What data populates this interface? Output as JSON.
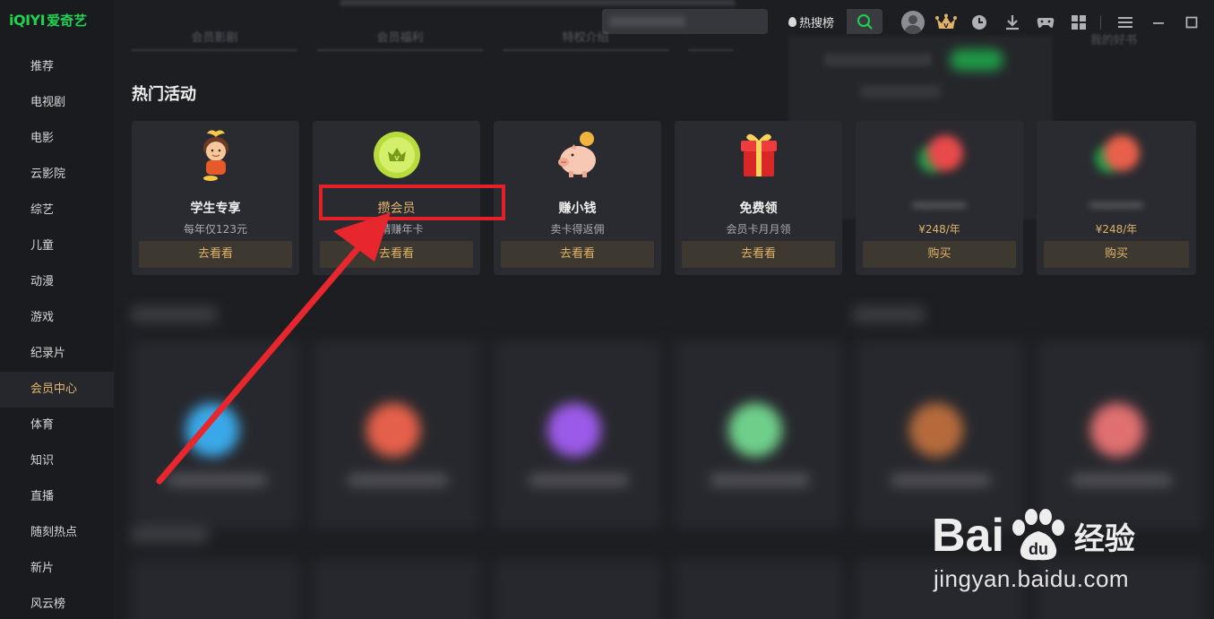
{
  "app": {
    "brand": "iQIYI",
    "brand_cn": "爱奇艺",
    "brand_color": "#1fd24f",
    "accent_color": "#e0b36a"
  },
  "sidebar": {
    "items": [
      {
        "label": "推荐"
      },
      {
        "label": "电视剧"
      },
      {
        "label": "电影"
      },
      {
        "label": "云影院"
      },
      {
        "label": "综艺"
      },
      {
        "label": "儿童"
      },
      {
        "label": "动漫"
      },
      {
        "label": "游戏"
      },
      {
        "label": "纪录片"
      },
      {
        "label": "会员中心",
        "active": true
      },
      {
        "label": "体育"
      },
      {
        "label": "知识"
      },
      {
        "label": "直播"
      },
      {
        "label": "随刻热点"
      },
      {
        "label": "新片"
      },
      {
        "label": "风云榜"
      }
    ]
  },
  "topbar": {
    "hot_list_label": "热搜榜",
    "icons": [
      "avatar",
      "vip-crown-icon",
      "history-icon",
      "download-icon",
      "game-icon",
      "apps-grid-icon",
      "menu-icon",
      "minimize-icon",
      "maximize-icon"
    ]
  },
  "categories": [
    "会员影剧",
    "会员福利",
    "特权介绍",
    "我的好书"
  ],
  "section": {
    "title": "热门活动"
  },
  "cards": [
    {
      "title": "学生专享",
      "sub": "每年仅123元",
      "button": "去看看",
      "icon": "student-mascot-icon"
    },
    {
      "title": "攒会员",
      "sub": "邀请赚年卡",
      "button": "去看看",
      "icon": "vip-coin-icon"
    },
    {
      "title": "赚小钱",
      "sub": "卖卡得返佣",
      "button": "去看看",
      "icon": "piggy-bank-icon"
    },
    {
      "title": "免费领",
      "sub": "会员卡月月领",
      "button": "去看看",
      "icon": "gift-box-icon"
    },
    {
      "title": "",
      "sub": "¥248/年",
      "button": "购买",
      "icon": "blurred-product-icon"
    },
    {
      "title": "",
      "sub": "¥248/年",
      "button": "购买",
      "icon": "blurred-product-icon"
    }
  ],
  "watermark": {
    "logo_left": "Bai",
    "logo_right": "du",
    "logo_cn": "经验",
    "url": "jingyan.baidu.com"
  },
  "annotation": {
    "highlight_color": "#e32129"
  }
}
